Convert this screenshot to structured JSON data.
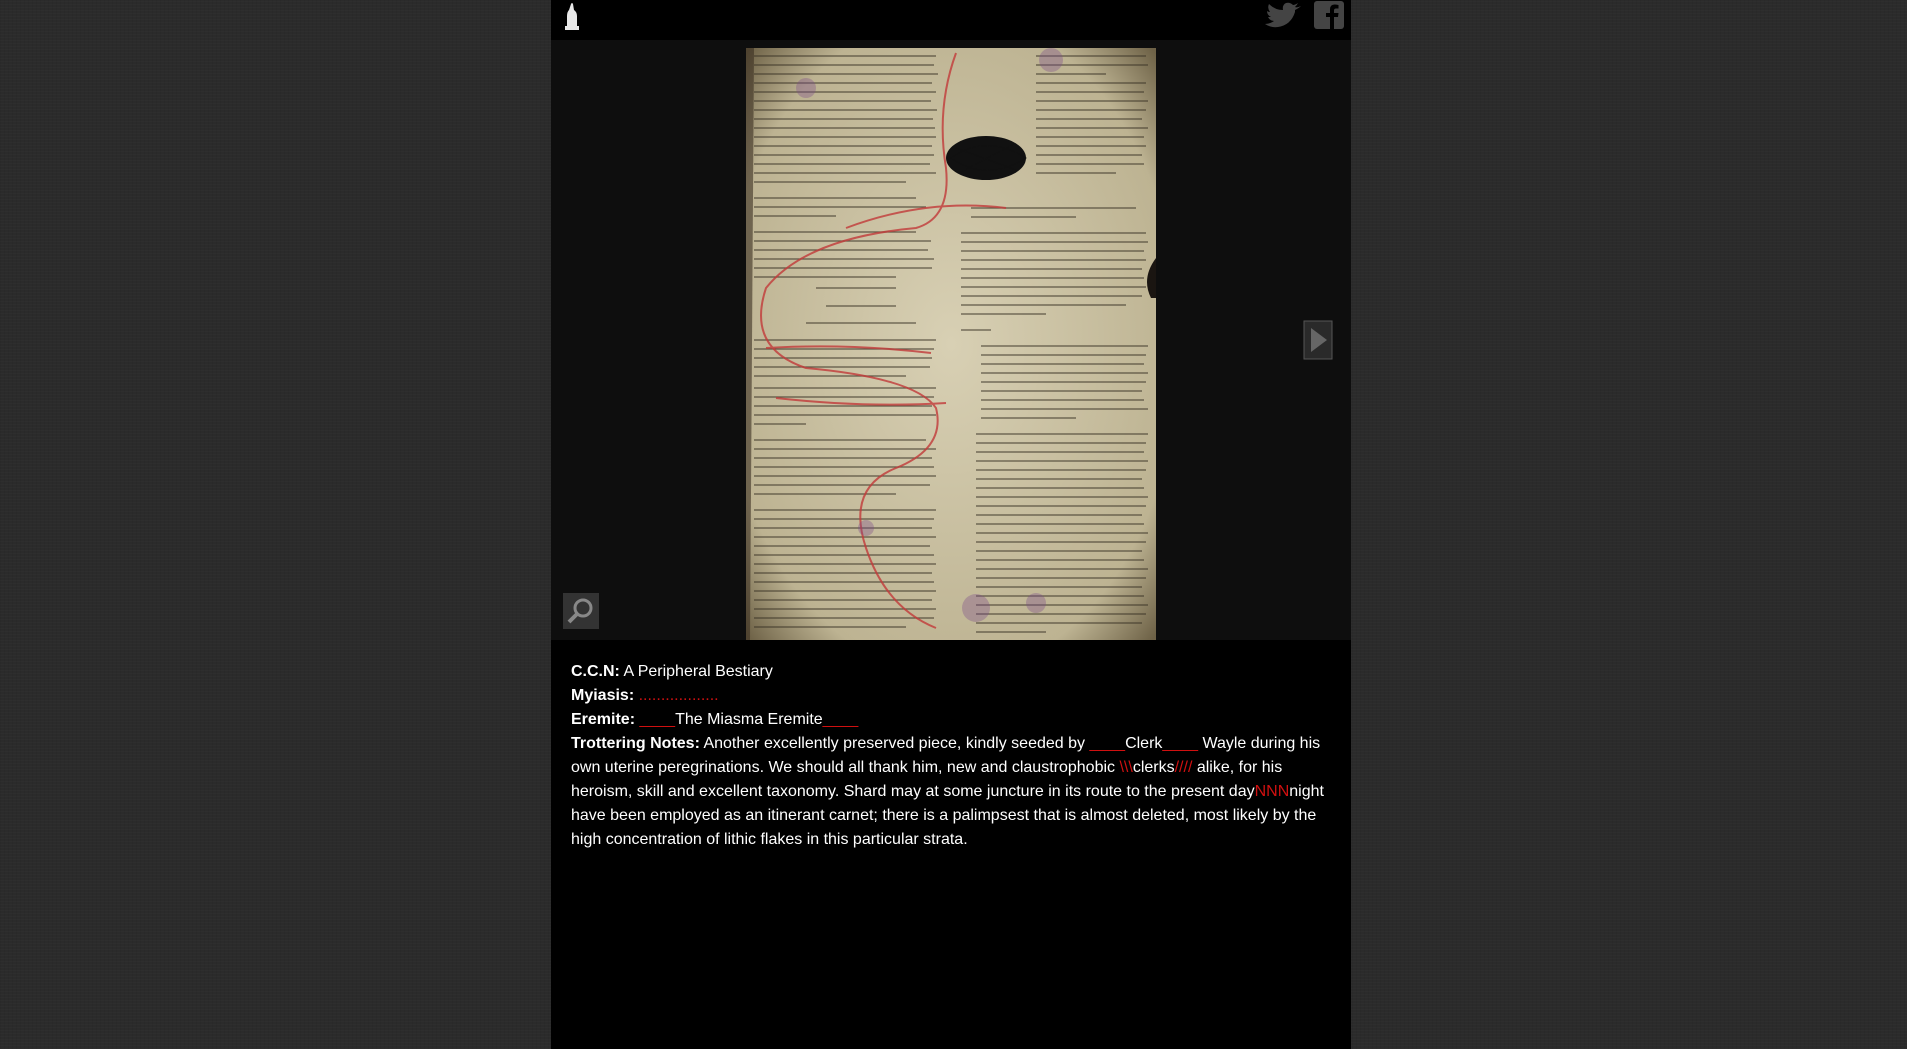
{
  "header": {
    "logo_icon": "quill-hand-icon",
    "twitter_icon": "twitter-icon",
    "facebook_icon": "facebook-icon"
  },
  "viewer": {
    "next_icon": "play-arrow-icon",
    "zoom_icon": "magnifier-icon"
  },
  "details": {
    "ccn_label": "C.C.N:",
    "ccn_value": "A Peripheral Bestiary",
    "myiasis_label": "Myiasis:",
    "myiasis_value": "..................",
    "eremite_label": "Eremite:",
    "eremite_pre": "____",
    "eremite_value": "The Miasma Eremite",
    "eremite_post": "____",
    "notes_label": "Trottering Notes:",
    "notes_1": "Another excellently preserved piece, kindly seeded by",
    "notes_gap1": "____",
    "notes_clerk": "Clerk",
    "notes_gap2": "____",
    "notes_2": "Wayle during his own uterine peregrinations. We should all thank him, new and claustrophobic",
    "notes_slash1": "\\\\\\",
    "notes_clerks": "clerks",
    "notes_slash2": "////",
    "notes_3": "alike, for his heroism, skill and excellent taxonomy. Shard may at some juncture in its route to the present day",
    "notes_nnn": "NNN",
    "notes_4": "night have been employed as an itinerant carnet; there is a palimpsest that is almost deleted, most likely by the high concentration of lithic flakes in this particular strata."
  },
  "colors": {
    "accent_red": "#d01010",
    "background": "#000000"
  }
}
